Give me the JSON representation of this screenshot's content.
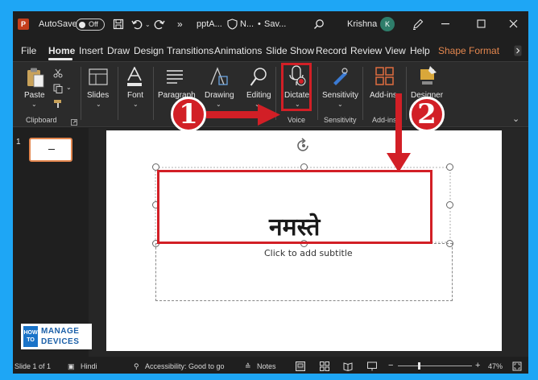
{
  "titlebar": {
    "autosave_label": "AutoSave",
    "autosave_toggle": "Off",
    "filename": "pptA...",
    "label_short": "N...",
    "save_status": "Sav...",
    "user_name": "Krishna",
    "user_initial": "K",
    "more": "»"
  },
  "tabs": [
    "File",
    "Home",
    "Insert",
    "Draw",
    "Design",
    "Transitions",
    "Animations",
    "Slide Show",
    "Record",
    "Review",
    "View",
    "Help",
    "Shape Format"
  ],
  "ribbon": {
    "paste": "Paste",
    "clipboard_group": "Clipboard",
    "slides": "Slides",
    "font": "Font",
    "paragraph": "Paragraph",
    "drawing": "Drawing",
    "editing": "Editing",
    "dictate": "Dictate",
    "voice_group": "Voice",
    "sensitivity": "Sensitivity",
    "sensitivity_group": "Sensitivity",
    "addins": "Add-ins",
    "addins_group": "Add-ins",
    "designer": "Designer"
  },
  "thumbnails": {
    "number": "1"
  },
  "slide": {
    "title": "नमस्ते",
    "subtitle_placeholder": "Click to add subtitle"
  },
  "annotations": {
    "step1": "1",
    "step2": "2"
  },
  "logo": {
    "how": "HOW",
    "to": "TO",
    "line1": "MANAGE",
    "line2": "DEVICES"
  },
  "status": {
    "slide_info": "Slide 1 of 1",
    "language": "Hindi",
    "accessibility": "Accessibility: Good to go",
    "notes": "Notes",
    "zoom_minus": "−",
    "zoom_plus": "+",
    "zoom": "47%"
  },
  "colors": {
    "annotation": "#d21f26",
    "accent": "#e3864e",
    "backdrop": "#1ea6f5"
  }
}
